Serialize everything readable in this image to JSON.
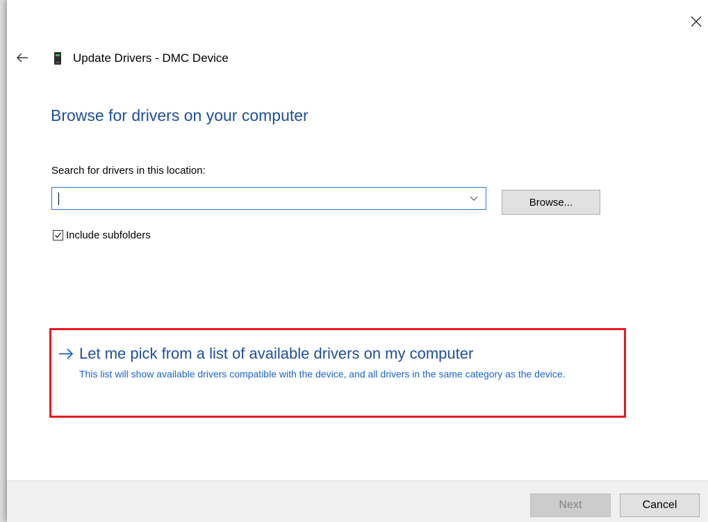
{
  "window": {
    "title": "Update Drivers - DMC Device",
    "icons": {
      "close": "close-icon",
      "back": "back-arrow-icon",
      "device": "device-icon"
    }
  },
  "main": {
    "heading": "Browse for drivers on your computer",
    "search_label": "Search for drivers in this location:",
    "path_value": "",
    "browse_label": "Browse...",
    "include_subfolders": {
      "label": "Include subfolders",
      "checked": true
    }
  },
  "pick_option": {
    "title": "Let me pick from a list of available drivers on my computer",
    "description": "This list will show available drivers compatible with the device, and all drivers in the same category as the device.",
    "icon": "right-arrow-icon"
  },
  "footer": {
    "next_label": "Next",
    "next_enabled": false,
    "cancel_label": "Cancel"
  },
  "colors": {
    "heading": "#1f4e9a",
    "link_description": "#1a64c8",
    "highlight_border": "#e8191f",
    "input_border": "#2878d2",
    "footer_bg": "#f0f0f0"
  }
}
